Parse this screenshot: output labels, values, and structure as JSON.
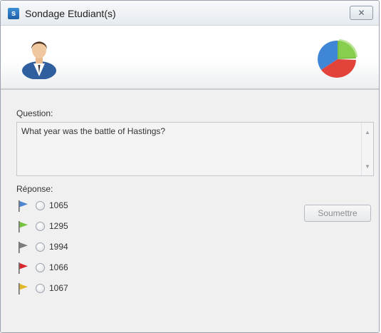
{
  "window": {
    "title": "Sondage Etudiant(s)",
    "close_glyph": "✕",
    "app_icon_letter": "s",
    "app_icon": "app-icon"
  },
  "header": {
    "left_icon": "user-icon",
    "right_icon": "pie-chart-icon"
  },
  "question": {
    "label": "Question:",
    "text": "What year was the battle of Hastings?",
    "scroll_up": "▲",
    "scroll_down": "▼"
  },
  "answers": {
    "label": "Réponse:",
    "items": [
      {
        "text": "1065",
        "flag_color": "#4a86d1",
        "flag_icon": "blue-flag-icon"
      },
      {
        "text": "1295",
        "flag_color": "#76c23d",
        "flag_icon": "green-flag-icon"
      },
      {
        "text": "1994",
        "flag_color": "#7b7b7b",
        "flag_icon": "gray-flag-icon"
      },
      {
        "text": "1066",
        "flag_color": "#d7262c",
        "flag_icon": "red-flag-icon"
      },
      {
        "text": "1067",
        "flag_color": "#e2b82a",
        "flag_icon": "yellow-flag-icon"
      }
    ]
  },
  "submit": {
    "label": "Soumettre"
  },
  "colors": {
    "titlebar": "#e6ebf0",
    "background": "#f0f0f0"
  }
}
